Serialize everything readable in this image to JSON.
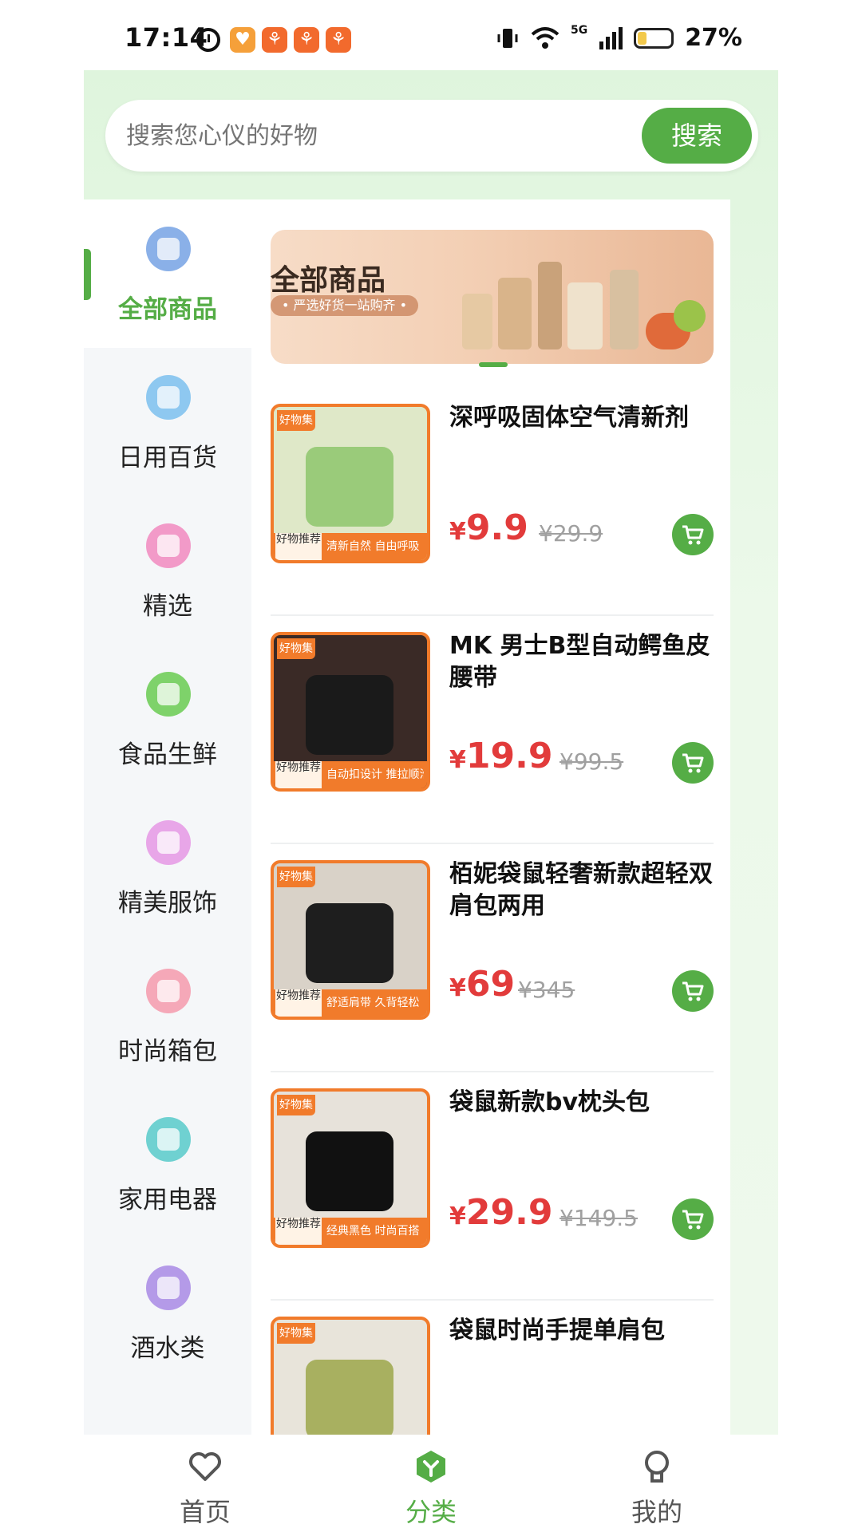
{
  "status_bar": {
    "time": "17:14",
    "network": "5G",
    "battery": "27%",
    "battery_level": 0.27,
    "app_icon_glyph": "⚘",
    "app_icon_alt": "♥"
  },
  "search": {
    "placeholder": "搜索您心仪的好物",
    "button_label": "搜索"
  },
  "sidebar": {
    "items": [
      {
        "label": "全部商品",
        "icon": "all-goods-icon",
        "color": "#8ab0e8",
        "active": true
      },
      {
        "label": "日用百货",
        "icon": "daily-goods-icon",
        "color": "#8ec8f0"
      },
      {
        "label": "精选",
        "icon": "heart-icon",
        "color": "#f29ac8"
      },
      {
        "label": "食品生鲜",
        "icon": "fruit-basket-icon",
        "color": "#7ed26a"
      },
      {
        "label": "精美服饰",
        "icon": "dress-icon",
        "color": "#e8a6e8"
      },
      {
        "label": "时尚箱包",
        "icon": "handbag-icon",
        "color": "#f5a8b8"
      },
      {
        "label": "家用电器",
        "icon": "appliance-icon",
        "color": "#6fd1d1"
      },
      {
        "label": "酒水类",
        "icon": "wine-icon",
        "color": "#b49ae8"
      }
    ]
  },
  "banner": {
    "title": "全部商品",
    "subtitle": "• 严选好货一站购齐 •"
  },
  "products": [
    {
      "title": "深呼吸固体空气清新剂",
      "currency": "¥",
      "price": "9.9",
      "original_price": "¥29.9",
      "tag1": "好物推荐",
      "tag2": "清新自然 自由呼吸",
      "logo": "好物集"
    },
    {
      "title": "MK 男士B型自动鳄鱼皮腰带",
      "currency": "¥",
      "price": "19.9",
      "original_price": "¥99.5",
      "tag1": "好物推荐",
      "tag2": "自动扣设计 推拉顺滑",
      "logo": "好物集"
    },
    {
      "title": "栢妮袋鼠轻奢新款超轻双肩包两用",
      "currency": "¥",
      "price": "69",
      "original_price": "¥345",
      "tag1": "好物推荐",
      "tag2": "舒适肩带 久背轻松",
      "logo": "好物集"
    },
    {
      "title": "袋鼠新款bv枕头包",
      "currency": "¥",
      "price": "29.9",
      "original_price": "¥149.5",
      "tag1": "好物推荐",
      "tag2": "经典黑色 时尚百搭",
      "logo": "好物集"
    },
    {
      "title": "袋鼠时尚手提单肩包",
      "currency": "¥",
      "price": "",
      "original_price": "",
      "tag1": "",
      "tag2": "",
      "logo": "好物集"
    }
  ],
  "tabbar": {
    "items": [
      {
        "label": "首页",
        "icon": "heart-outline-icon"
      },
      {
        "label": "分类",
        "icon": "category-icon",
        "active": true
      },
      {
        "label": "我的",
        "icon": "profile-icon"
      }
    ]
  },
  "colors": {
    "accent": "#55ad46",
    "price": "#e23b3b",
    "badge": "#f17b2b"
  }
}
